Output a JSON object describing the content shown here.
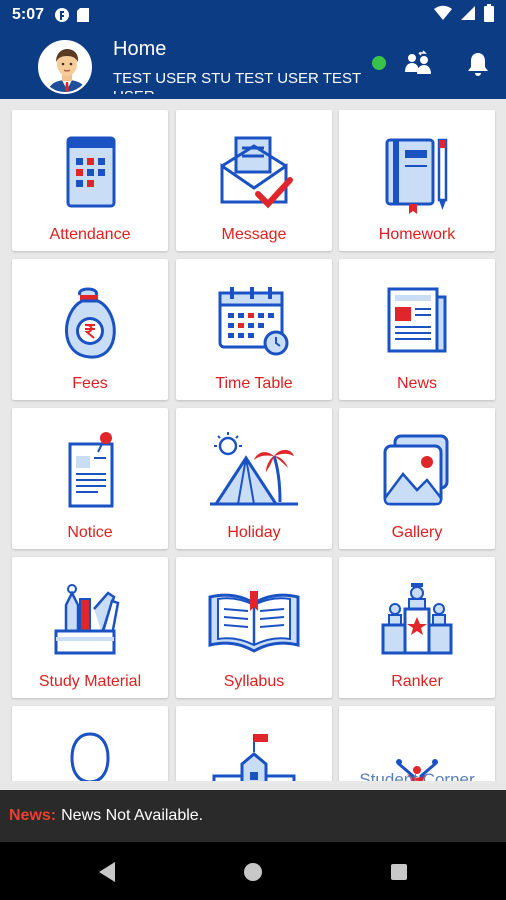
{
  "status_bar": {
    "time": "5:07",
    "left_icons": [
      "app-notification-icon",
      "sd-card-icon"
    ],
    "right_icons": [
      "wifi-icon",
      "cellular-signal-icon",
      "battery-icon"
    ]
  },
  "header": {
    "title": "Home",
    "subtitle": "TEST USER STU TEST USER TEST USER",
    "online_status_color": "#39c34a",
    "background_color": "#0b3c84",
    "icons": [
      "switch-user-icon",
      "notification-bell-icon"
    ]
  },
  "tiles": [
    {
      "label": "Attendance",
      "icon": "attendance-calendar-icon"
    },
    {
      "label": "Message",
      "icon": "message-envelope-icon"
    },
    {
      "label": "Homework",
      "icon": "homework-book-icon"
    },
    {
      "label": "Fees",
      "icon": "fees-money-bag-icon"
    },
    {
      "label": "Time Table",
      "icon": "time-table-calendar-icon"
    },
    {
      "label": "News",
      "icon": "newspaper-icon"
    },
    {
      "label": "Notice",
      "icon": "notice-pinned-paper-icon"
    },
    {
      "label": "Holiday",
      "icon": "holiday-beach-icon"
    },
    {
      "label": "Gallery",
      "icon": "gallery-picture-icon"
    },
    {
      "label": "Study Material",
      "icon": "study-material-tools-icon"
    },
    {
      "label": "Syllabus",
      "icon": "syllabus-open-book-icon"
    },
    {
      "label": "Ranker",
      "icon": "ranker-podium-icon"
    },
    {
      "label": "",
      "icon": "profile-person-icon"
    },
    {
      "label": "",
      "icon": "school-building-icon"
    },
    {
      "label": "Student Corner",
      "icon": "student-corner-logo-icon"
    }
  ],
  "colors": {
    "accent": "#dd1f1f",
    "icon_blue": "#1a52c4",
    "icon_fill": "#c9ddf6",
    "icon_red": "#e0262b"
  },
  "news": {
    "label": "News:",
    "text": "News Not Available."
  },
  "nav_bar": {
    "buttons": [
      "back-icon",
      "home-icon",
      "recents-icon"
    ]
  }
}
